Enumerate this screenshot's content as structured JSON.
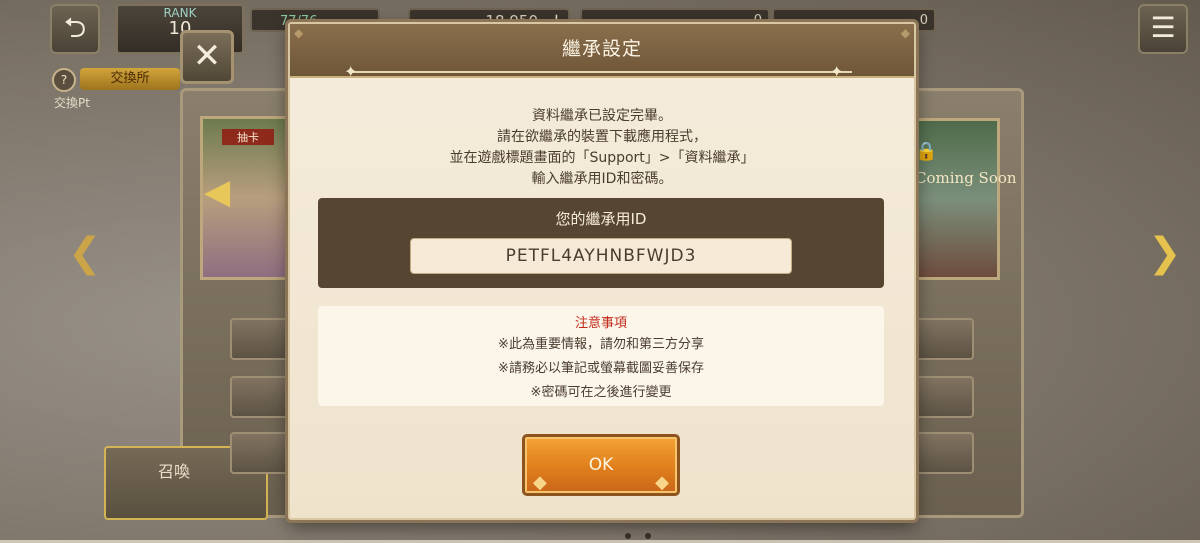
{
  "topbar": {
    "rank_label": "RANK",
    "rank_value": "10",
    "stamina": "77/76",
    "gold": "18,950",
    "gold_plus": "+",
    "gem1": "0",
    "gem2": "0"
  },
  "exchange": {
    "help": "?",
    "tab_label": "交換所",
    "pt_label": "交換Pt"
  },
  "background": {
    "card_left_title": "抽卡",
    "card_right_text": "Coming Soon",
    "bottom_label": "召喚"
  },
  "dialog": {
    "title": "繼承設定",
    "message_lines": [
      "資料繼承已設定完畢。",
      "請在欲繼承的裝置下載應用程式，",
      "並在遊戲標題畫面的「Support」>「資料繼承」",
      "輸入繼承用ID和密碼。"
    ],
    "id_label": "您的繼承用ID",
    "id_value": "PETFL4AYHNBFWJD3",
    "notice_title": "注意事項",
    "notices": [
      "※此為重要情報，請勿和第三方分享",
      "※請務必以筆記或螢幕截圖妥善保存",
      "※密碼可在之後進行變更"
    ],
    "ok_label": "OK"
  },
  "colors": {
    "dialog_bg": "#f5ecdc",
    "title_bar": "#7a6244",
    "id_box": "#564531",
    "notice_red": "#c22a1c",
    "ok_orange": "#e88a24"
  },
  "icons": [
    "back-arrow-icon",
    "stamina-icon",
    "gold-icon",
    "gem-icon",
    "menu-icon",
    "close-icon",
    "lock-icon",
    "chevron-left-icon",
    "chevron-right-icon"
  ]
}
